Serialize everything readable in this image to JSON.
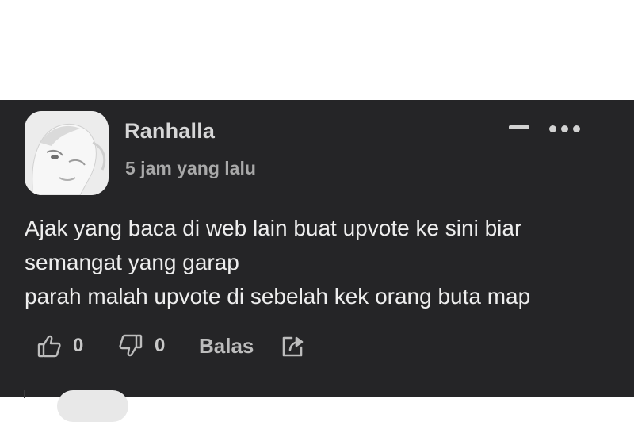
{
  "comment": {
    "username": "Ranhalla",
    "timestamp": "5 jam yang lalu",
    "body_lines": [
      "Ajak yang baca di web lain buat upvote ke sini biar",
      "semangat yang garap",
      "parah malah upvote di sebelah kek orang buta map"
    ],
    "likes": "0",
    "dislikes": "0",
    "reply_label": "Balas"
  },
  "icons": {
    "collapse": "minus-icon",
    "more": "more-horizontal-icon",
    "like": "thumbs-up-icon",
    "dislike": "thumbs-down-icon",
    "share": "share-icon"
  },
  "colors": {
    "panel_background": "#252527",
    "username": "#d7d7d7",
    "timestamp": "#a9a9a9",
    "body_text": "#eeeeee"
  }
}
